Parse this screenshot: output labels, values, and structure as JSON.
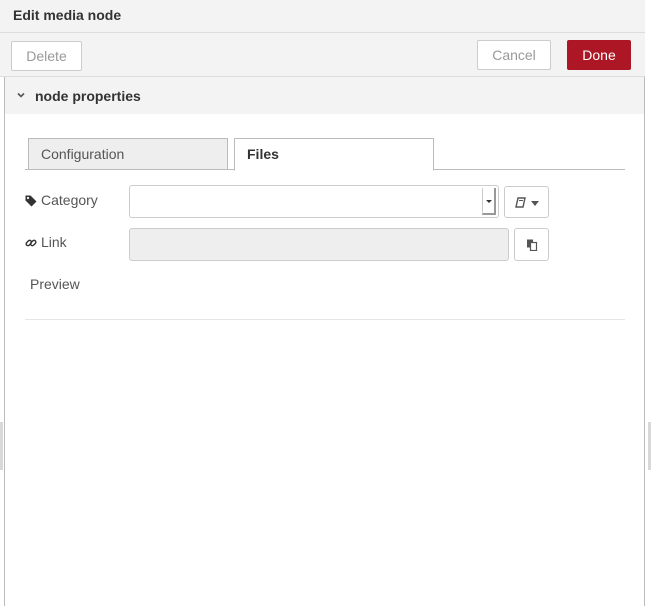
{
  "header": {
    "title": "Edit media node"
  },
  "toolbar": {
    "delete_label": "Delete",
    "cancel_label": "Cancel",
    "done_label": "Done"
  },
  "section": {
    "label": "node properties"
  },
  "tabs": [
    {
      "label": "Configuration",
      "active": false
    },
    {
      "label": "Files",
      "active": true
    }
  ],
  "form": {
    "category": {
      "label": "Category",
      "value": ""
    },
    "link": {
      "label": "Link",
      "value": ""
    },
    "preview": {
      "label": "Preview"
    }
  },
  "colors": {
    "primary": "#ad1625",
    "panel": "#f3f3f3",
    "border": "#cccccc"
  },
  "icons": [
    "chevron-down-icon",
    "tag-icon",
    "link-icon",
    "book-icon",
    "caret-down-icon",
    "copy-icon"
  ]
}
